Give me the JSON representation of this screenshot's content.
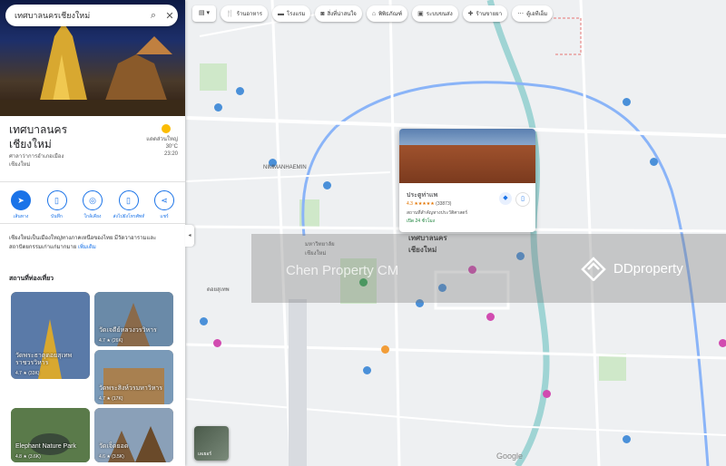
{
  "search": {
    "query": "เทศบาลนครเชียงใหม่"
  },
  "place": {
    "name": "เทศบาลนคร\nเชียงใหม่",
    "subtitle": "ศาลาว่าการอำเภอเมือง\nเชียงใหม่",
    "weather_condition": "แดดส่วนใหญ่",
    "weather_temp": "30°C",
    "weather_time": "23:20"
  },
  "actions": [
    {
      "label": "เส้นทาง",
      "icon": "directions-icon"
    },
    {
      "label": "บันทึก",
      "icon": "bookmark-icon"
    },
    {
      "label": "ใกล้เคียง",
      "icon": "nearby-icon"
    },
    {
      "label": "ส่งไปยังโทรศัพท์",
      "icon": "phone-icon"
    },
    {
      "label": "แชร์",
      "icon": "share-icon"
    }
  ],
  "description": "เชียงใหม่เป็นเมืองใหญ่ทางภาคเหนือของไทย มีวัดวาอารามและสถาปัตยกรรมเก่าแก่มากมาย",
  "description_more": "เพิ่มเติม",
  "section_title": "สถานที่ท่องเที่ยว",
  "cards": [
    {
      "name": "วัดพระธาตุดอยสุเทพ\nราชวรวิหาร",
      "rating": "4.7 ★ (33K)",
      "color": "#c99a2e"
    },
    {
      "name": "วัดเจดีย์หลวงวรวิหาร",
      "rating": "4.7 ★ (26K)",
      "color": "#8a6a4a"
    },
    {
      "name": "วัดพระสิงห์วรมหาวิหาร",
      "rating": "4.7 ★ (17K)",
      "color": "#a88050"
    },
    {
      "name": "Elephant Nature Park",
      "rating": "4.8 ★ (3.6K)",
      "color": "#4a6a3a"
    },
    {
      "name": "วัดเจ็ดยอด",
      "rating": "4.6 ★ (3.5K)",
      "color": "#7a5a3a"
    }
  ],
  "chips": [
    {
      "label": "ร้านอาหาร",
      "icon": "fork-icon"
    },
    {
      "label": "โรงแรม",
      "icon": "bed-icon"
    },
    {
      "label": "สิ่งที่น่าสนใจ",
      "icon": "camera-icon"
    },
    {
      "label": "พิพิธภัณฑ์",
      "icon": "museum-icon"
    },
    {
      "label": "ระบบขนส่ง",
      "icon": "transit-icon"
    },
    {
      "label": "ร้านขายยา",
      "icon": "pharmacy-icon"
    },
    {
      "label": "ตู้เอทีเอ็ม",
      "icon": "atm-icon"
    }
  ],
  "popup": {
    "name": "ประตูท่าแพ",
    "rating": "4.3 ★★★★★",
    "reviews": "(33873)",
    "type": "สถานที่สำคัญทางประวัติศาสตร์",
    "status": "เปิด 24 ชั่วโมง"
  },
  "map_labels": [
    {
      "text": "NIMMANHAEMIN",
      "big": false
    },
    {
      "text": "เทศบาลนคร\nเชียงใหม่",
      "big": true
    },
    {
      "text": "มหาวิทยาลัย\nเชียงใหม่",
      "big": false
    },
    {
      "text": "ดอยสุเทพ",
      "big": false
    }
  ],
  "watermark": {
    "left": "Chen Property CM",
    "right": "DDproperty"
  },
  "layers_label": "เลเยอร์",
  "google_logo": "Google",
  "colors": {
    "accent": "#1a73e8",
    "road": "#ffffff",
    "river": "#9fd4d4",
    "ring_road": "#8ab4f8",
    "park": "#cfe8c9"
  }
}
